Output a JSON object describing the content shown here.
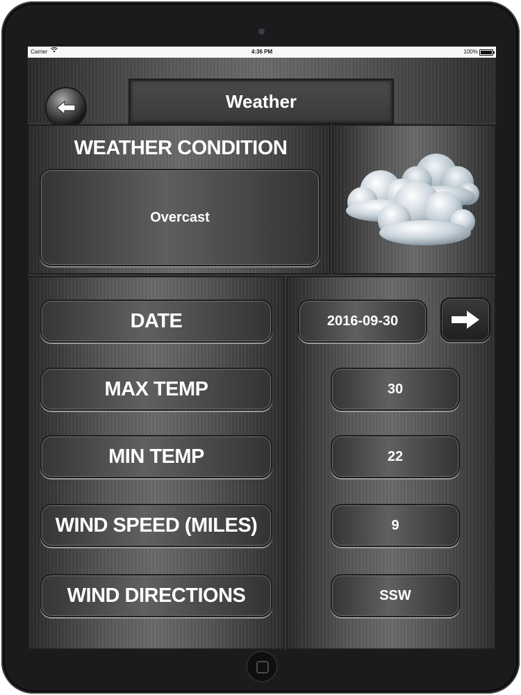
{
  "status_bar": {
    "carrier": "Carrier",
    "time": "4:36 PM",
    "battery": "100%"
  },
  "header": {
    "title": "Weather"
  },
  "condition": {
    "heading": "WEATHER CONDITION",
    "value": "Overcast",
    "icon": "overcast-cloud-icon"
  },
  "rows": [
    {
      "label": "DATE",
      "value": "2016-09-30"
    },
    {
      "label": "MAX TEMP",
      "value": "30"
    },
    {
      "label": "MIN TEMP",
      "value": "22"
    },
    {
      "label": "WIND SPEED (MILES)",
      "value": "9"
    },
    {
      "label": "WIND DIRECTIONS",
      "value": "SSW"
    }
  ],
  "icons": {
    "back": "arrow-left-icon",
    "next": "arrow-right-icon"
  }
}
